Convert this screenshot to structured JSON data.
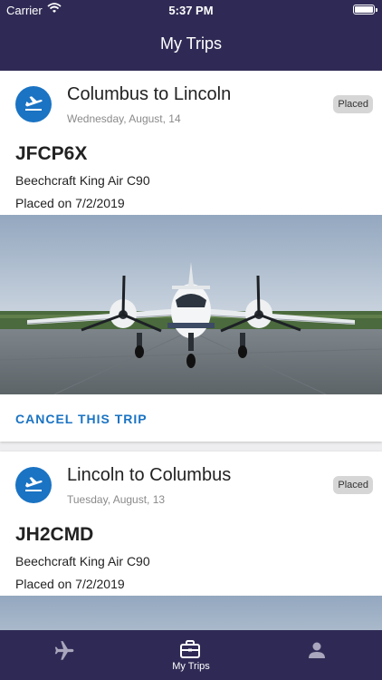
{
  "status_bar": {
    "carrier": "Carrier",
    "time": "5:37 PM"
  },
  "header": {
    "title": "My Trips"
  },
  "trips": [
    {
      "route": "Columbus to Lincoln",
      "date": "Wednesday, August, 14",
      "status": "Placed",
      "code": "JFCP6X",
      "aircraft": "Beechcraft King Air C90",
      "placed_on": "Placed on 7/2/2019",
      "action_label": "CANCEL THIS TRIP"
    },
    {
      "route": "Lincoln to Columbus",
      "date": "Tuesday, August, 13",
      "status": "Placed",
      "code": "JH2CMD",
      "aircraft": "Beechcraft King Air C90",
      "placed_on": "Placed on 7/2/2019"
    }
  ],
  "tab_bar": {
    "tabs": [
      {
        "label": "",
        "icon": "airplane-icon"
      },
      {
        "label": "My Trips",
        "icon": "briefcase-icon"
      },
      {
        "label": "",
        "icon": "person-icon"
      }
    ],
    "selected": "My Trips"
  },
  "colors": {
    "nav_background": "#2f2a55",
    "accent": "#1a73c3",
    "badge_background": "#d6d6d6"
  }
}
